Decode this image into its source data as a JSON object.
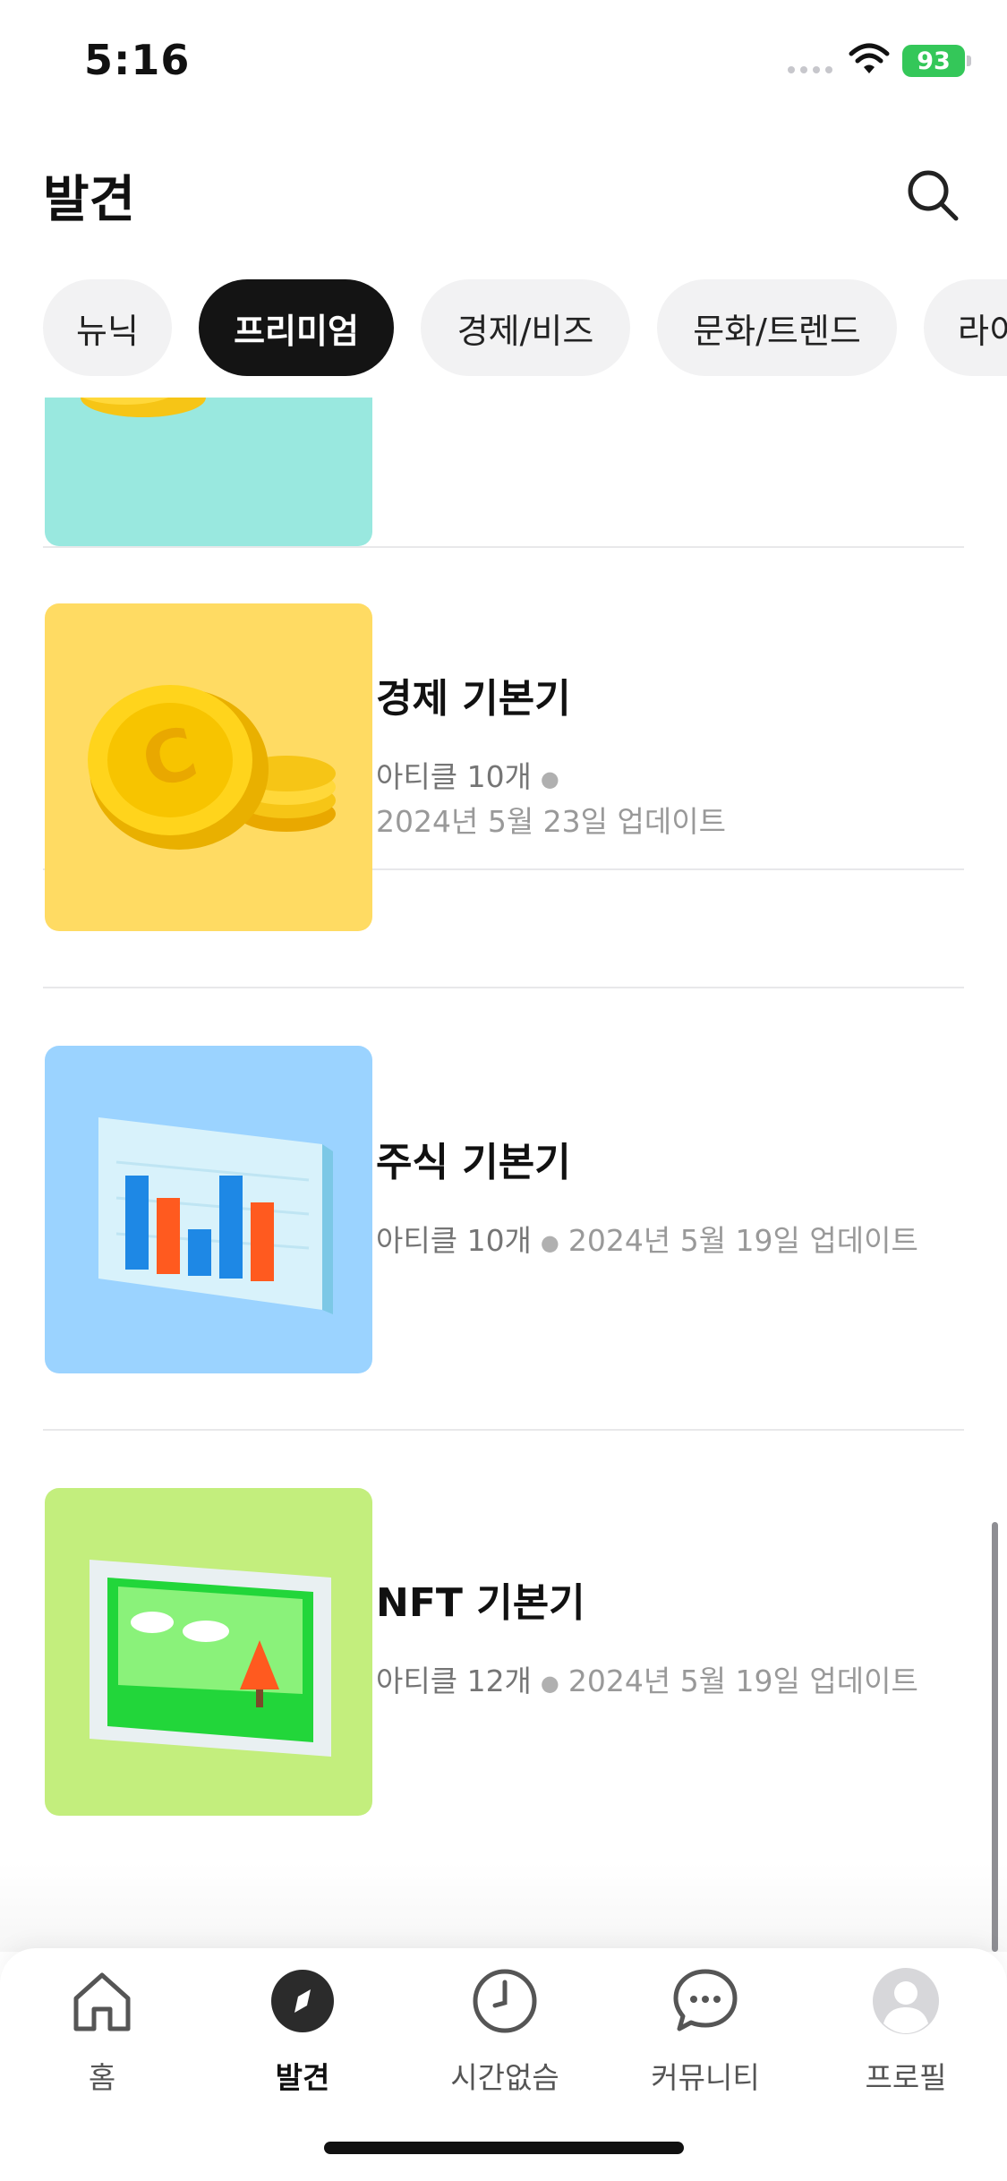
{
  "status": {
    "time": "5:16",
    "battery": "93"
  },
  "header": {
    "title": "발견"
  },
  "chips": [
    {
      "label": "뉴닉",
      "active": false
    },
    {
      "label": "프리미엄",
      "active": true
    },
    {
      "label": "경제/비즈",
      "active": false
    },
    {
      "label": "문화/트렌드",
      "active": false
    },
    {
      "label": "라이",
      "active": false
    }
  ],
  "items": [
    {
      "title": "경제 기본기",
      "count": "아티클 10개",
      "date": "2024년 5월 23일 업데이트",
      "thumb_color": "#ffdb63",
      "icon": "gold-coins-icon"
    },
    {
      "title": "주식 기본기",
      "count": "아티클 10개",
      "date": "2024년 5월 19일 업데이트",
      "thumb_color": "#9bd3ff",
      "icon": "bar-chart-icon"
    },
    {
      "title": "NFT 기본기",
      "count": "아티클 12개",
      "date": "2024년 5월 19일 업데이트",
      "thumb_color": "#c3ee7d",
      "icon": "framed-picture-icon"
    }
  ],
  "partial_item": {
    "thumb_color": "#99e8df"
  },
  "tabs": [
    {
      "label": "홈",
      "icon": "home-icon",
      "active": false
    },
    {
      "label": "발견",
      "icon": "compass-icon",
      "active": true
    },
    {
      "label": "시간없슴",
      "icon": "clock-icon",
      "active": false
    },
    {
      "label": "커뮤니티",
      "icon": "chat-bubble-icon",
      "active": false
    },
    {
      "label": "프로필",
      "icon": "avatar-icon",
      "active": false
    }
  ],
  "colors": {
    "active_chip": "#141414",
    "inactive_chip": "#f2f2f3",
    "battery": "#34c759"
  }
}
